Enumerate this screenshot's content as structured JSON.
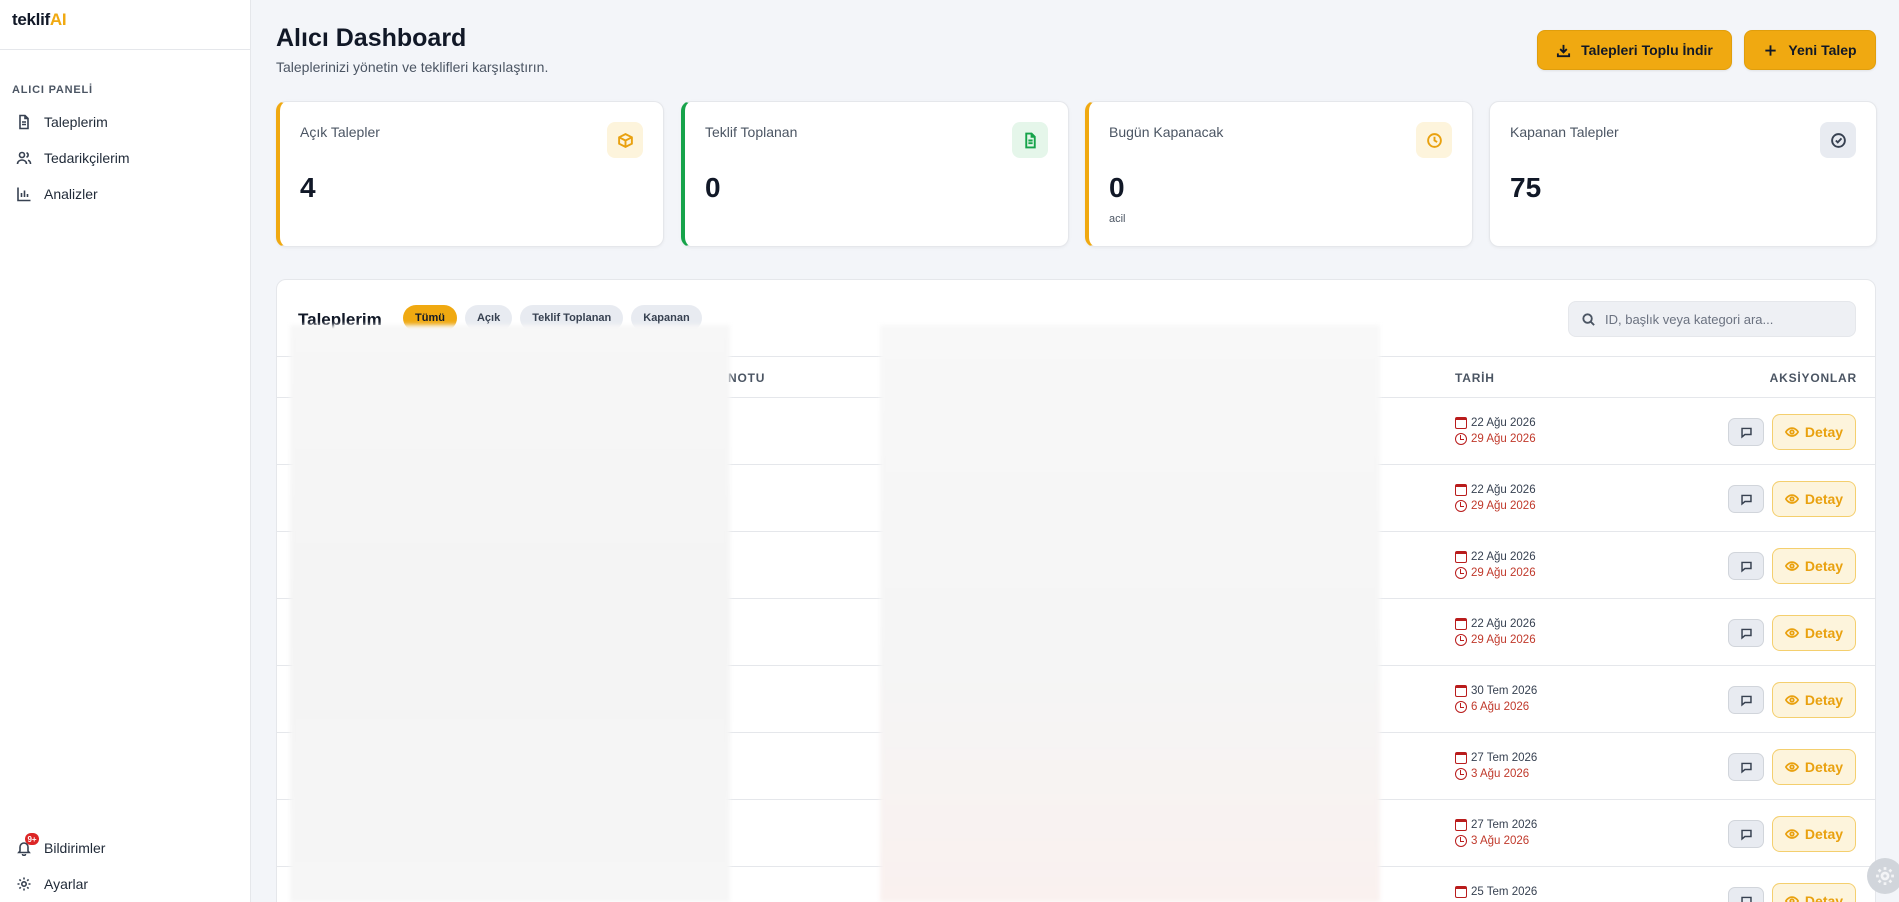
{
  "brand": {
    "part1": "teklif",
    "part2": "AI"
  },
  "sidebar": {
    "section": "ALICI PANELİ",
    "items": [
      {
        "label": "Taleplerim",
        "icon": "document-icon"
      },
      {
        "label": "Tedarikçilerim",
        "icon": "users-icon"
      },
      {
        "label": "Analizler",
        "icon": "bar-chart-icon"
      }
    ],
    "bottom": [
      {
        "label": "Bildirimler",
        "icon": "bell-icon",
        "badge": "9+"
      },
      {
        "label": "Ayarlar",
        "icon": "gear-icon"
      }
    ]
  },
  "header": {
    "title": "Alıcı Dashboard",
    "subtitle": "Taleplerinizi yönetin ve teklifleri karşılaştırın.",
    "bulk_download": "Talepleri Toplu İndir",
    "new_request": "Yeni Talep"
  },
  "stats": [
    {
      "label": "Açık Talepler",
      "value": "4",
      "note": "",
      "icon": "box-icon"
    },
    {
      "label": "Teklif Toplanan",
      "value": "0",
      "note": "",
      "icon": "file-text-icon"
    },
    {
      "label": "Bugün Kapanacak",
      "value": "0",
      "note": "acil",
      "icon": "clock-icon"
    },
    {
      "label": "Kapanan Talepler",
      "value": "75",
      "note": "",
      "icon": "check-circle-icon"
    }
  ],
  "table": {
    "title": "Taleplerim",
    "filters": [
      "Tümü",
      "Açık",
      "Teklif Toplanan",
      "Kapanan"
    ],
    "active_filter": "Tümü",
    "search_placeholder": "ID, başlık veya kategori ara...",
    "columns": {
      "notu": "NOTU",
      "tarih": "TARİH",
      "aksiyonlar": "AKSİYONLAR"
    },
    "detail_label": "Detay",
    "rows": [
      {
        "created": "22 Ağu 2026",
        "deadline": "29 Ağu 2026"
      },
      {
        "created": "22 Ağu 2026",
        "deadline": "29 Ağu 2026"
      },
      {
        "created": "22 Ağu 2026",
        "deadline": "29 Ağu 2026"
      },
      {
        "created": "22 Ağu 2026",
        "deadline": "29 Ağu 2026"
      },
      {
        "created": "30 Tem 2026",
        "deadline": "6 Ağu 2026"
      },
      {
        "created": "27 Tem 2026",
        "deadline": "3 Ağu 2026"
      },
      {
        "created": "27 Tem 2026",
        "deadline": "3 Ağu 2026"
      },
      {
        "created": "25 Tem 2026",
        "deadline": ""
      }
    ]
  },
  "colors": {
    "accent": "#f0a911",
    "green": "#16a34a",
    "danger": "#c0392b"
  }
}
